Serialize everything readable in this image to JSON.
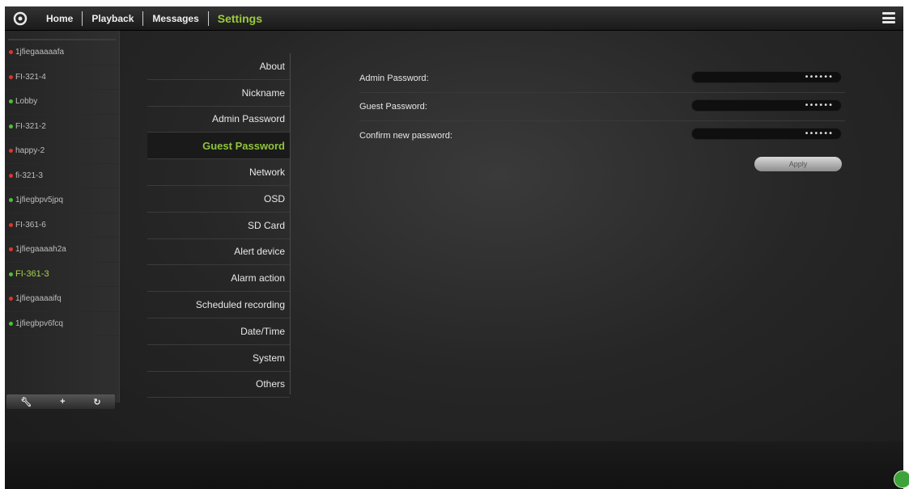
{
  "nav": {
    "items": [
      {
        "label": "Home",
        "active": false
      },
      {
        "label": "Playback",
        "active": false
      },
      {
        "label": "Messages",
        "active": false
      },
      {
        "label": "Settings",
        "active": true
      }
    ]
  },
  "devices": [
    {
      "name": "1jfiegaaaaafa",
      "status": "red"
    },
    {
      "name": "FI-321-4",
      "status": "red"
    },
    {
      "name": "Lobby",
      "status": "green"
    },
    {
      "name": "FI-321-2",
      "status": "green"
    },
    {
      "name": "happy-2",
      "status": "red"
    },
    {
      "name": "fi-321-3",
      "status": "red"
    },
    {
      "name": "1jfiegbpv5jpq",
      "status": "green"
    },
    {
      "name": "FI-361-6",
      "status": "red"
    },
    {
      "name": "1jfiegaaaah2a",
      "status": "red"
    },
    {
      "name": "FI-361-3",
      "status": "green",
      "selected": true
    },
    {
      "name": "1jfiegaaaaifq",
      "status": "red"
    },
    {
      "name": "1jfiegbpv6fcq",
      "status": "green"
    }
  ],
  "device_toolbar": {
    "settings_icon": "wrench-icon",
    "add_icon": "plus-icon",
    "refresh_icon": "refresh-icon"
  },
  "settings_menu": [
    {
      "label": "About"
    },
    {
      "label": "Nickname"
    },
    {
      "label": "Admin Password"
    },
    {
      "label": "Guest Password",
      "active": true
    },
    {
      "label": "Network"
    },
    {
      "label": "OSD"
    },
    {
      "label": "SD Card"
    },
    {
      "label": "Alert device"
    },
    {
      "label": "Alarm action"
    },
    {
      "label": "Scheduled recording"
    },
    {
      "label": "Date/Time"
    },
    {
      "label": "System"
    },
    {
      "label": "Others"
    }
  ],
  "form": {
    "rows": [
      {
        "label": "Admin Password:",
        "value": "••••••"
      },
      {
        "label": "Guest Password:",
        "value": "••••••"
      },
      {
        "label": "Confirm new password:",
        "value": "••••••"
      }
    ],
    "apply_label": "Apply"
  },
  "colors": {
    "accent_green": "#9ccc3a",
    "status_red": "#e0342b",
    "status_green": "#4fbf3a"
  }
}
